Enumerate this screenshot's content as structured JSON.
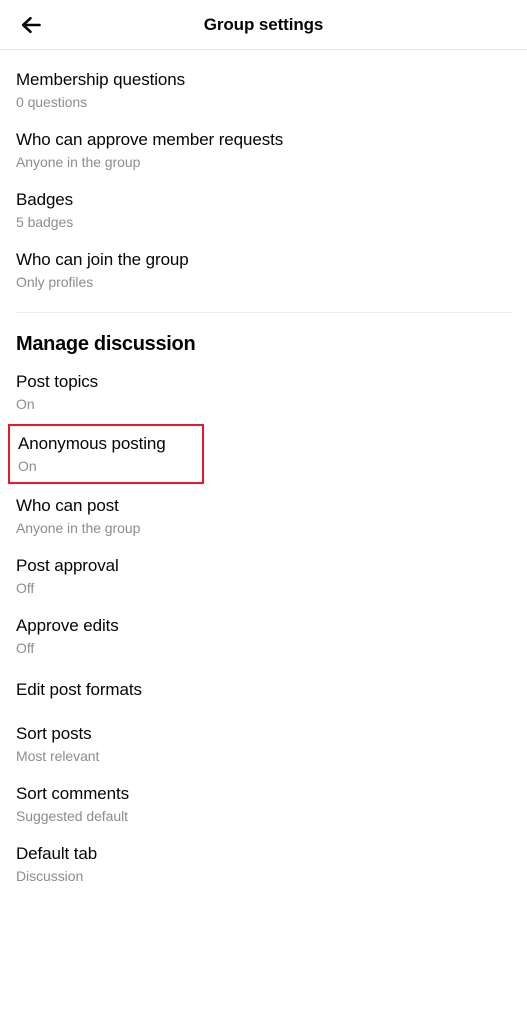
{
  "header": {
    "back_icon": "arrow-left-icon",
    "title": "Group settings"
  },
  "sections": [
    {
      "heading": null,
      "items": [
        {
          "title": "Membership questions",
          "subtitle": "0 questions",
          "highlighted": false
        },
        {
          "title": "Who can approve member requests",
          "subtitle": "Anyone in the group",
          "highlighted": false
        },
        {
          "title": "Badges",
          "subtitle": "5 badges",
          "highlighted": false
        },
        {
          "title": "Who can join the group",
          "subtitle": "Only profiles",
          "highlighted": false
        }
      ]
    },
    {
      "heading": "Manage discussion",
      "items": [
        {
          "title": "Post topics",
          "subtitle": "On",
          "highlighted": false
        },
        {
          "title": "Anonymous posting",
          "subtitle": "On",
          "highlighted": true
        },
        {
          "title": "Who can post",
          "subtitle": "Anyone in the group",
          "highlighted": false
        },
        {
          "title": "Post approval",
          "subtitle": "Off",
          "highlighted": false
        },
        {
          "title": "Approve edits",
          "subtitle": "Off",
          "highlighted": false
        },
        {
          "title": "Edit post formats",
          "subtitle": null,
          "highlighted": false
        },
        {
          "title": "Sort posts",
          "subtitle": "Most relevant",
          "highlighted": false
        },
        {
          "title": "Sort comments",
          "subtitle": "Suggested default",
          "highlighted": false
        },
        {
          "title": "Default tab",
          "subtitle": "Discussion",
          "highlighted": false
        }
      ]
    }
  ],
  "colors": {
    "text_primary": "#050505",
    "text_secondary": "#8a8d91",
    "divider": "#e9eaec",
    "highlight_border": "#e8192c",
    "background": "#ffffff"
  }
}
